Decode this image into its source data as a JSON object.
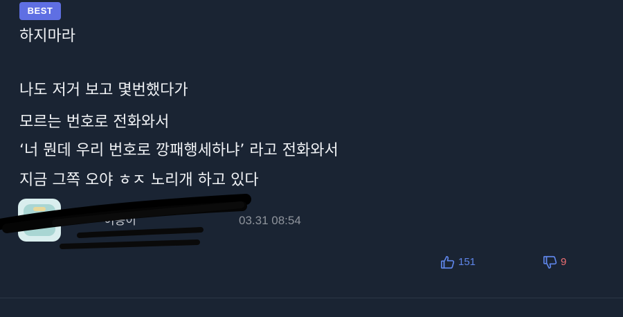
{
  "comment": {
    "badge": "BEST",
    "lines": [
      "하지마라",
      "",
      "나도 저거 보고 몇번했다가",
      "모르는 번호로 전화와서",
      "‘너 뭔데 우리 번호로 깡패행세하냐’ 라고 전화와서",
      "지금 그쪽 오야 ㅎㅈ 노리개 하고 있다"
    ],
    "author": "이동이",
    "date": "03.31 08:54",
    "likes": "151",
    "dislikes": "9"
  },
  "colors": {
    "background": "#1a2433",
    "badge": "#5f6fe3",
    "like": "#5f86ea",
    "dislike": "#f06f73"
  },
  "icons": {
    "like": "thumbs-up-icon",
    "dislike": "thumbs-down-icon"
  }
}
